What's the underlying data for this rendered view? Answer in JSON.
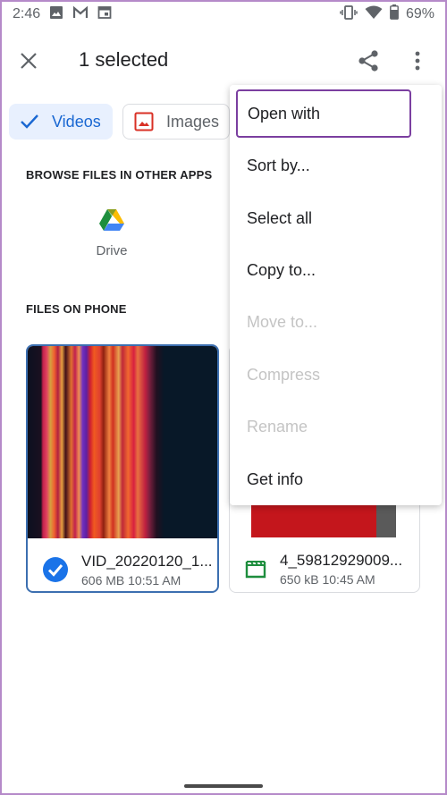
{
  "status_bar": {
    "time": "2:46",
    "notification_icons": [
      "photos-icon",
      "gmail-icon",
      "calendar-icon"
    ],
    "system_icons": [
      "vibrate-icon",
      "wifi-icon",
      "battery-icon"
    ],
    "battery_percent": "69%"
  },
  "app_bar": {
    "title": "1 selected",
    "close_icon": "close-icon",
    "share_icon": "share-icon",
    "more_icon": "more-vert-icon"
  },
  "filters": [
    {
      "label": "Videos",
      "selected": true,
      "icon": "check-icon"
    },
    {
      "label": "Images",
      "selected": false,
      "icon": "image-icon"
    }
  ],
  "browse_section": {
    "title": "BROWSE FILES IN OTHER APPS",
    "apps": [
      {
        "label": "Drive",
        "icon": "google-drive-icon"
      }
    ]
  },
  "files_section": {
    "title": "FILES ON PHONE",
    "files": [
      {
        "name": "VID_20220120_1...",
        "size": "606 MB",
        "time": "10:51 AM",
        "selected": true
      },
      {
        "name": "4_59812929009...",
        "size": "650 kB",
        "time": "10:45 AM",
        "selected": false
      }
    ]
  },
  "overflow_menu": {
    "items": [
      {
        "label": "Open with",
        "enabled": true,
        "focused": true
      },
      {
        "label": "Sort by...",
        "enabled": true
      },
      {
        "label": "Select all",
        "enabled": true
      },
      {
        "label": "Copy to...",
        "enabled": true
      },
      {
        "label": "Move to...",
        "enabled": false
      },
      {
        "label": "Compress",
        "enabled": false
      },
      {
        "label": "Rename",
        "enabled": false
      },
      {
        "label": "Get info",
        "enabled": true
      }
    ]
  },
  "colors": {
    "accent": "#1a73e8",
    "focus_outline": "#7b3fa0",
    "disabled_text": "#c4c4c4",
    "video_icon": "#1e8e3e"
  }
}
